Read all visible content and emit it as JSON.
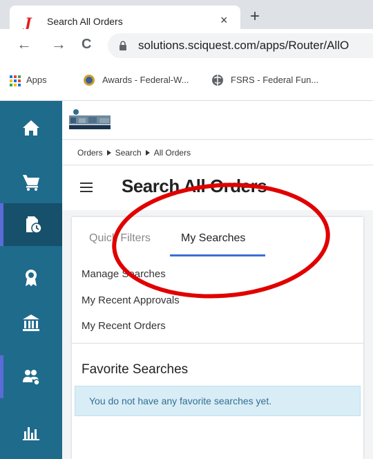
{
  "browser": {
    "tab_title": "Search All Orders",
    "tab_close": "×",
    "new_tab": "+",
    "url": "solutions.sciquest.com/apps/Router/AllO",
    "back": "←",
    "forward": "→",
    "reload": "C"
  },
  "bookmarks": {
    "apps": "Apps",
    "awards": "Awards - Federal-W...",
    "fsrs": "FSRS - Federal Fun..."
  },
  "breadcrumb": [
    "Orders",
    "Search",
    "All Orders"
  ],
  "page_title": "Search All Orders",
  "tabs": {
    "quick_filters": "Quick Filters",
    "my_searches": "My Searches"
  },
  "links": [
    "Manage Searches",
    "My Recent Approvals",
    "My Recent Orders"
  ],
  "favorites": {
    "title": "Favorite Searches",
    "empty_message": "You do not have any favorite searches yet."
  },
  "colors": {
    "nav_bg": "#1f6b8c",
    "nav_active": "#16506a",
    "accent": "#3b6ed6",
    "annotation": "#e00000"
  },
  "icons": [
    "home-icon",
    "cart-icon",
    "orders-clock-icon",
    "award-icon",
    "bank-icon",
    "people-icon",
    "bar-chart-icon"
  ]
}
